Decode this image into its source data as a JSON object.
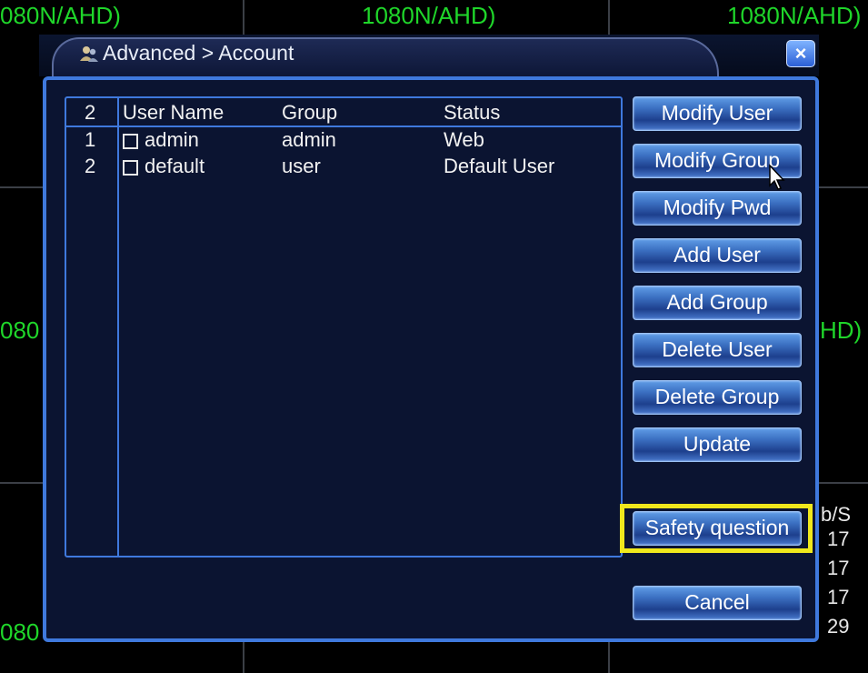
{
  "background": {
    "channel_labels": [
      "080N/AHD)",
      "1080N/AHD)",
      "1080N/AHD)",
      "080",
      "HD)",
      "080"
    ],
    "side_numbers": [
      "b/S",
      "17",
      "17",
      "17",
      "29"
    ]
  },
  "dialog": {
    "title": "Advanced > Account",
    "close_label": "×",
    "table": {
      "count_header": "2",
      "columns": [
        "User Name",
        "Group",
        "Status"
      ],
      "rows": [
        {
          "index": "1",
          "user": "admin",
          "group": "admin",
          "status": "Web"
        },
        {
          "index": "2",
          "user": "default",
          "group": "user",
          "status": "Default User"
        }
      ]
    },
    "buttons": {
      "modify_user": "Modify User",
      "modify_group": "Modify Group",
      "modify_pwd": "Modify Pwd",
      "add_user": "Add User",
      "add_group": "Add Group",
      "delete_user": "Delete User",
      "delete_group": "Delete Group",
      "update": "Update",
      "safety_question": "Safety question",
      "cancel": "Cancel"
    }
  },
  "colors": {
    "accent_border": "#3f79dd",
    "highlight": "#f0e81c",
    "channel_text": "#1fd62a"
  }
}
